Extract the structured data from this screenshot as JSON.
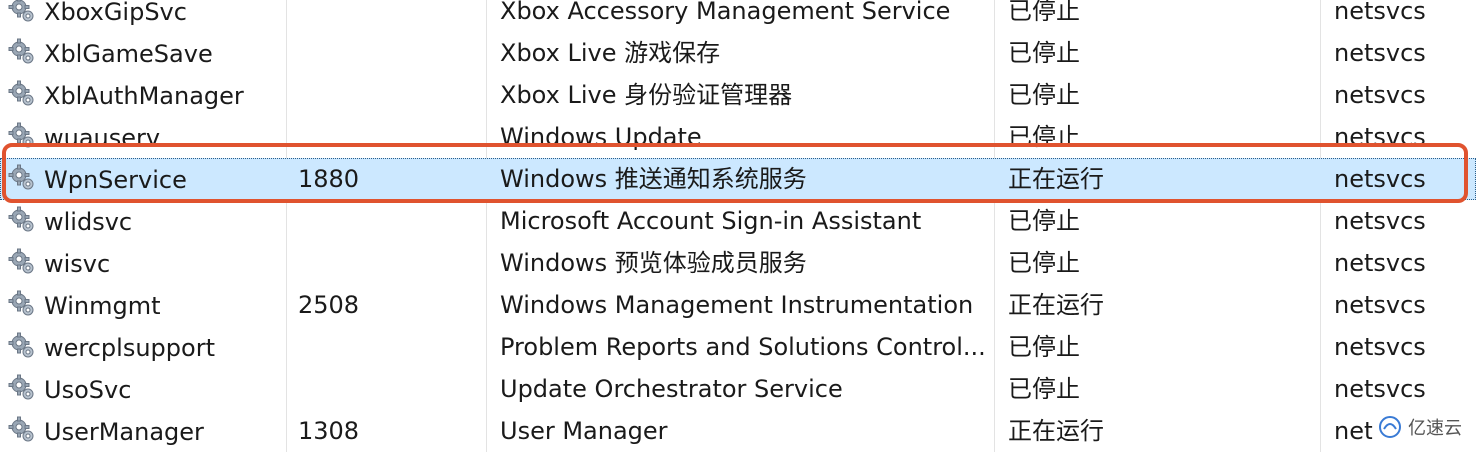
{
  "services": [
    {
      "name": "XboxGipSvc",
      "pid": "",
      "description": "Xbox Accessory Management Service",
      "status": "已停止",
      "group": "netsvcs",
      "selected": false
    },
    {
      "name": "XblGameSave",
      "pid": "",
      "description": "Xbox Live 游戏保存",
      "status": "已停止",
      "group": "netsvcs",
      "selected": false
    },
    {
      "name": "XblAuthManager",
      "pid": "",
      "description": "Xbox Live 身份验证管理器",
      "status": "已停止",
      "group": "netsvcs",
      "selected": false
    },
    {
      "name": "wuauserv",
      "pid": "",
      "description": "Windows Update",
      "status": "已停止",
      "group": "netsvcs",
      "selected": false
    },
    {
      "name": "WpnService",
      "pid": "1880",
      "description": "Windows 推送通知系统服务",
      "status": "正在运行",
      "group": "netsvcs",
      "selected": true
    },
    {
      "name": "wlidsvc",
      "pid": "",
      "description": "Microsoft Account Sign-in Assistant",
      "status": "已停止",
      "group": "netsvcs",
      "selected": false
    },
    {
      "name": "wisvc",
      "pid": "",
      "description": "Windows 预览体验成员服务",
      "status": "已停止",
      "group": "netsvcs",
      "selected": false
    },
    {
      "name": "Winmgmt",
      "pid": "2508",
      "description": "Windows Management Instrumentation",
      "status": "正在运行",
      "group": "netsvcs",
      "selected": false
    },
    {
      "name": "wercplsupport",
      "pid": "",
      "description": "Problem Reports and Solutions Control...",
      "status": "已停止",
      "group": "netsvcs",
      "selected": false
    },
    {
      "name": "UsoSvc",
      "pid": "",
      "description": "Update Orchestrator Service",
      "status": "已停止",
      "group": "netsvcs",
      "selected": false
    },
    {
      "name": "UserManager",
      "pid": "1308",
      "description": "User Manager",
      "status": "正在运行",
      "group": "net",
      "selected": false
    }
  ],
  "icons": {
    "service": "gear-icon",
    "watermark": "yisu-logo-icon"
  },
  "watermark": {
    "text": "亿速云"
  },
  "colors": {
    "selection": "#cce8ff",
    "highlight_border": "#e0532f"
  }
}
